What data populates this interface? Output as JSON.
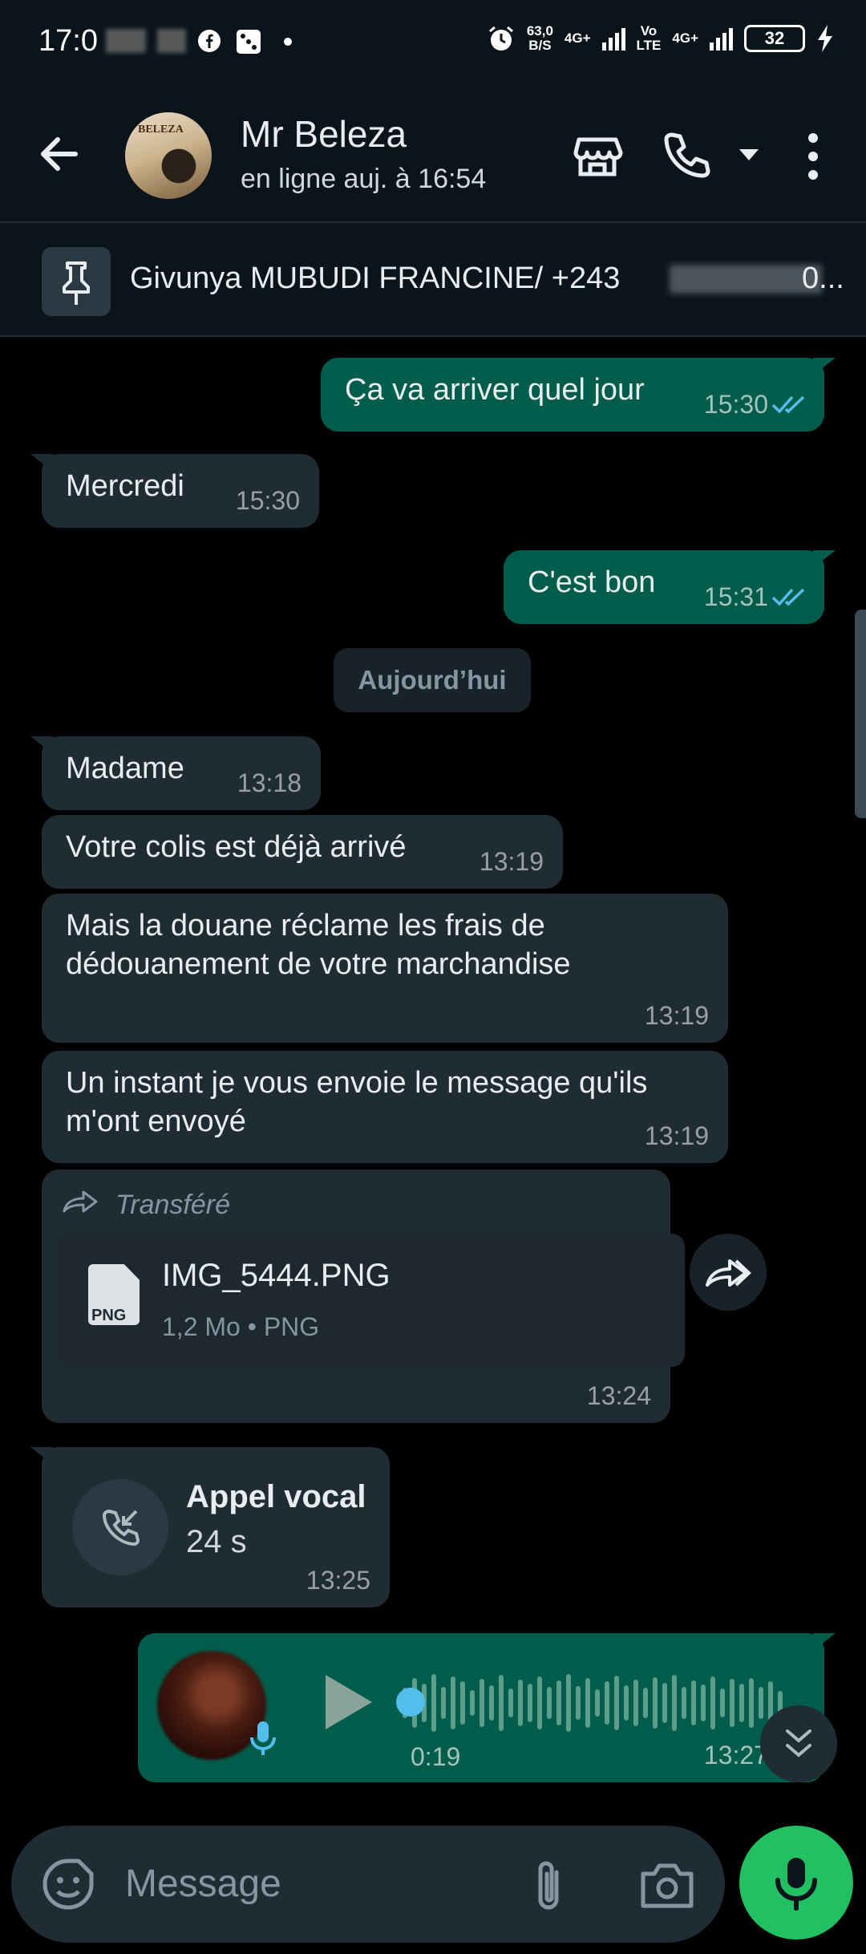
{
  "status_bar": {
    "time": "17:0",
    "net_speed_top": "63,0",
    "net_speed_bottom": "B/S",
    "net_a": "4G+",
    "volte_top": "Vo",
    "volte_bottom": "LTE",
    "net_b": "4G+",
    "battery": "32"
  },
  "header": {
    "contact_name": "Mr Beleza",
    "status": "en ligne auj. à 16:54",
    "avatar_text": "BELEZA"
  },
  "pinned": {
    "text": "Givunya MUBUDI FRANCINE/ +243",
    "text_tail": "0..."
  },
  "messages": [
    {
      "dir": "out",
      "text": "Ça va arriver quel jour",
      "time": "15:30"
    },
    {
      "dir": "in",
      "text": "Mercredi",
      "time": "15:30"
    },
    {
      "dir": "out",
      "text": "C'est bon",
      "time": "15:31"
    },
    {
      "dir": "in",
      "text": "Madame",
      "time": "13:18"
    },
    {
      "dir": "in",
      "text": "Votre colis est déjà arrivé",
      "time": "13:19"
    },
    {
      "dir": "in",
      "text": "Mais la douane réclame les frais de dédouanement de votre marchandise",
      "time": "13:19"
    },
    {
      "dir": "in",
      "text": "Un instant je vous envoie le message qu'ils m'ont envoyé",
      "time": "13:19"
    }
  ],
  "date_separator": "Aujourd’hui",
  "forwarded": {
    "label": "Transféré",
    "file_name": "IMG_5444.PNG",
    "file_meta": "1,2 Mo • PNG",
    "file_type": "PNG",
    "time": "13:24"
  },
  "call": {
    "title": "Appel vocal",
    "duration": "24 s",
    "time": "13:25"
  },
  "voice": {
    "duration": "0:19",
    "time": "13:27"
  },
  "composer": {
    "placeholder": "Message"
  },
  "colors": {
    "incoming": "#202c33",
    "outgoing": "#005c4b",
    "accent": "#21c063",
    "tick": "#53bdeb"
  }
}
